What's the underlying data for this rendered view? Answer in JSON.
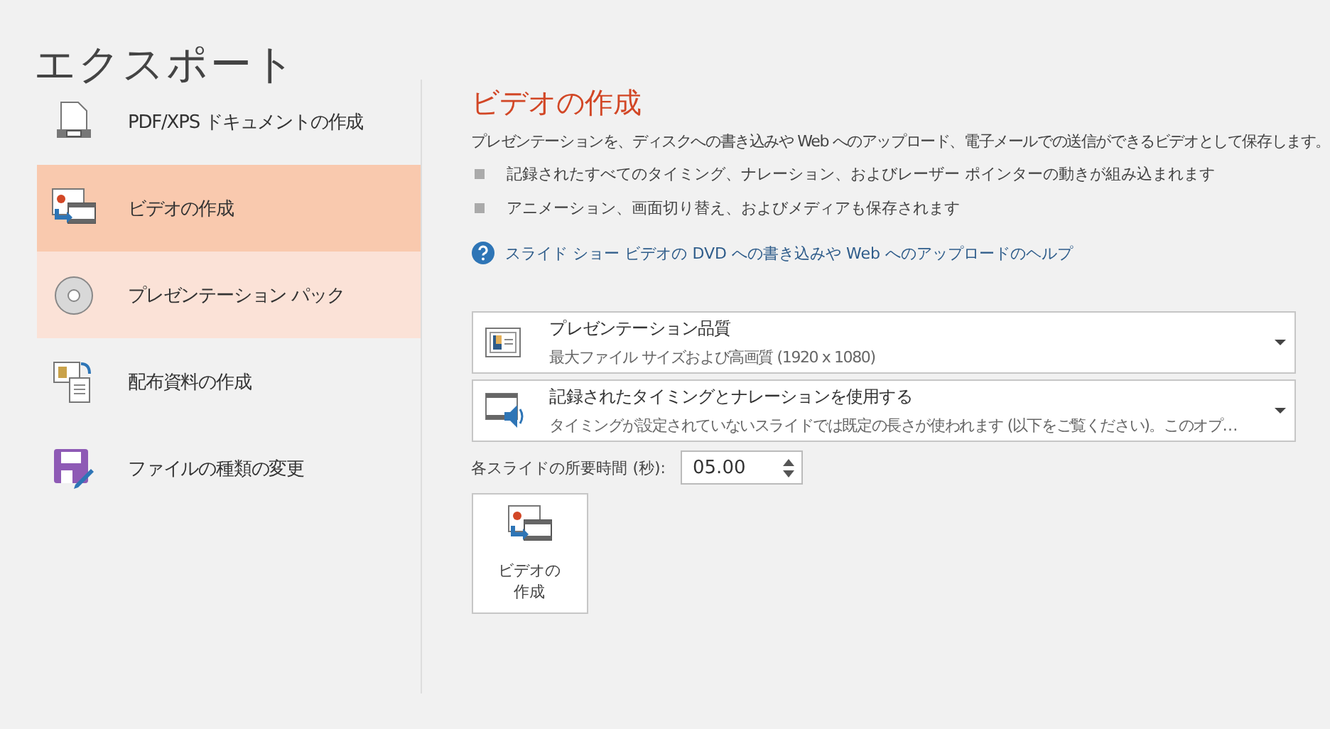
{
  "page_title": "エクスポート",
  "sidebar": {
    "items": [
      {
        "label": "PDF/XPS ドキュメントの作成",
        "kind": "pdf",
        "selected": false,
        "hovered": false
      },
      {
        "label": "ビデオの作成",
        "kind": "video",
        "selected": true,
        "hovered": false
      },
      {
        "label": "プレゼンテーション パック",
        "kind": "cd",
        "selected": false,
        "hovered": true
      },
      {
        "label": "配布資料の作成",
        "kind": "handout",
        "selected": false,
        "hovered": false
      },
      {
        "label": "ファイルの種類の変更",
        "kind": "save",
        "selected": false,
        "hovered": false
      }
    ]
  },
  "content": {
    "heading": "ビデオの作成",
    "description": "プレゼンテーションを、ディスクへの書き込みや Web へのアップロード、電子メールでの送信ができるビデオとして保存します。",
    "bullets": [
      "記録されたすべてのタイミング、ナレーション、およびレーザー ポインターの動きが組み込まれます",
      "アニメーション、画面切り替え、およびメディアも保存されます"
    ],
    "help_link": "スライド ショー ビデオの DVD への書き込みや Web へのアップロードのヘルプ",
    "dropdowns": [
      {
        "kind": "quality",
        "title": "プレゼンテーション品質",
        "subtitle": "最大ファイル サイズおよび高画質 (1920 x 1080)"
      },
      {
        "kind": "timing",
        "title": "記録されたタイミングとナレーションを使用する",
        "subtitle": "タイミングが設定されていないスライドでは既定の長さが使われます (以下をご覧ください)。このオプ…"
      }
    ],
    "duration": {
      "label": "各スライドの所要時間 (秒):",
      "value": "05.00"
    },
    "create_button": {
      "label": "ビデオの作成"
    }
  }
}
